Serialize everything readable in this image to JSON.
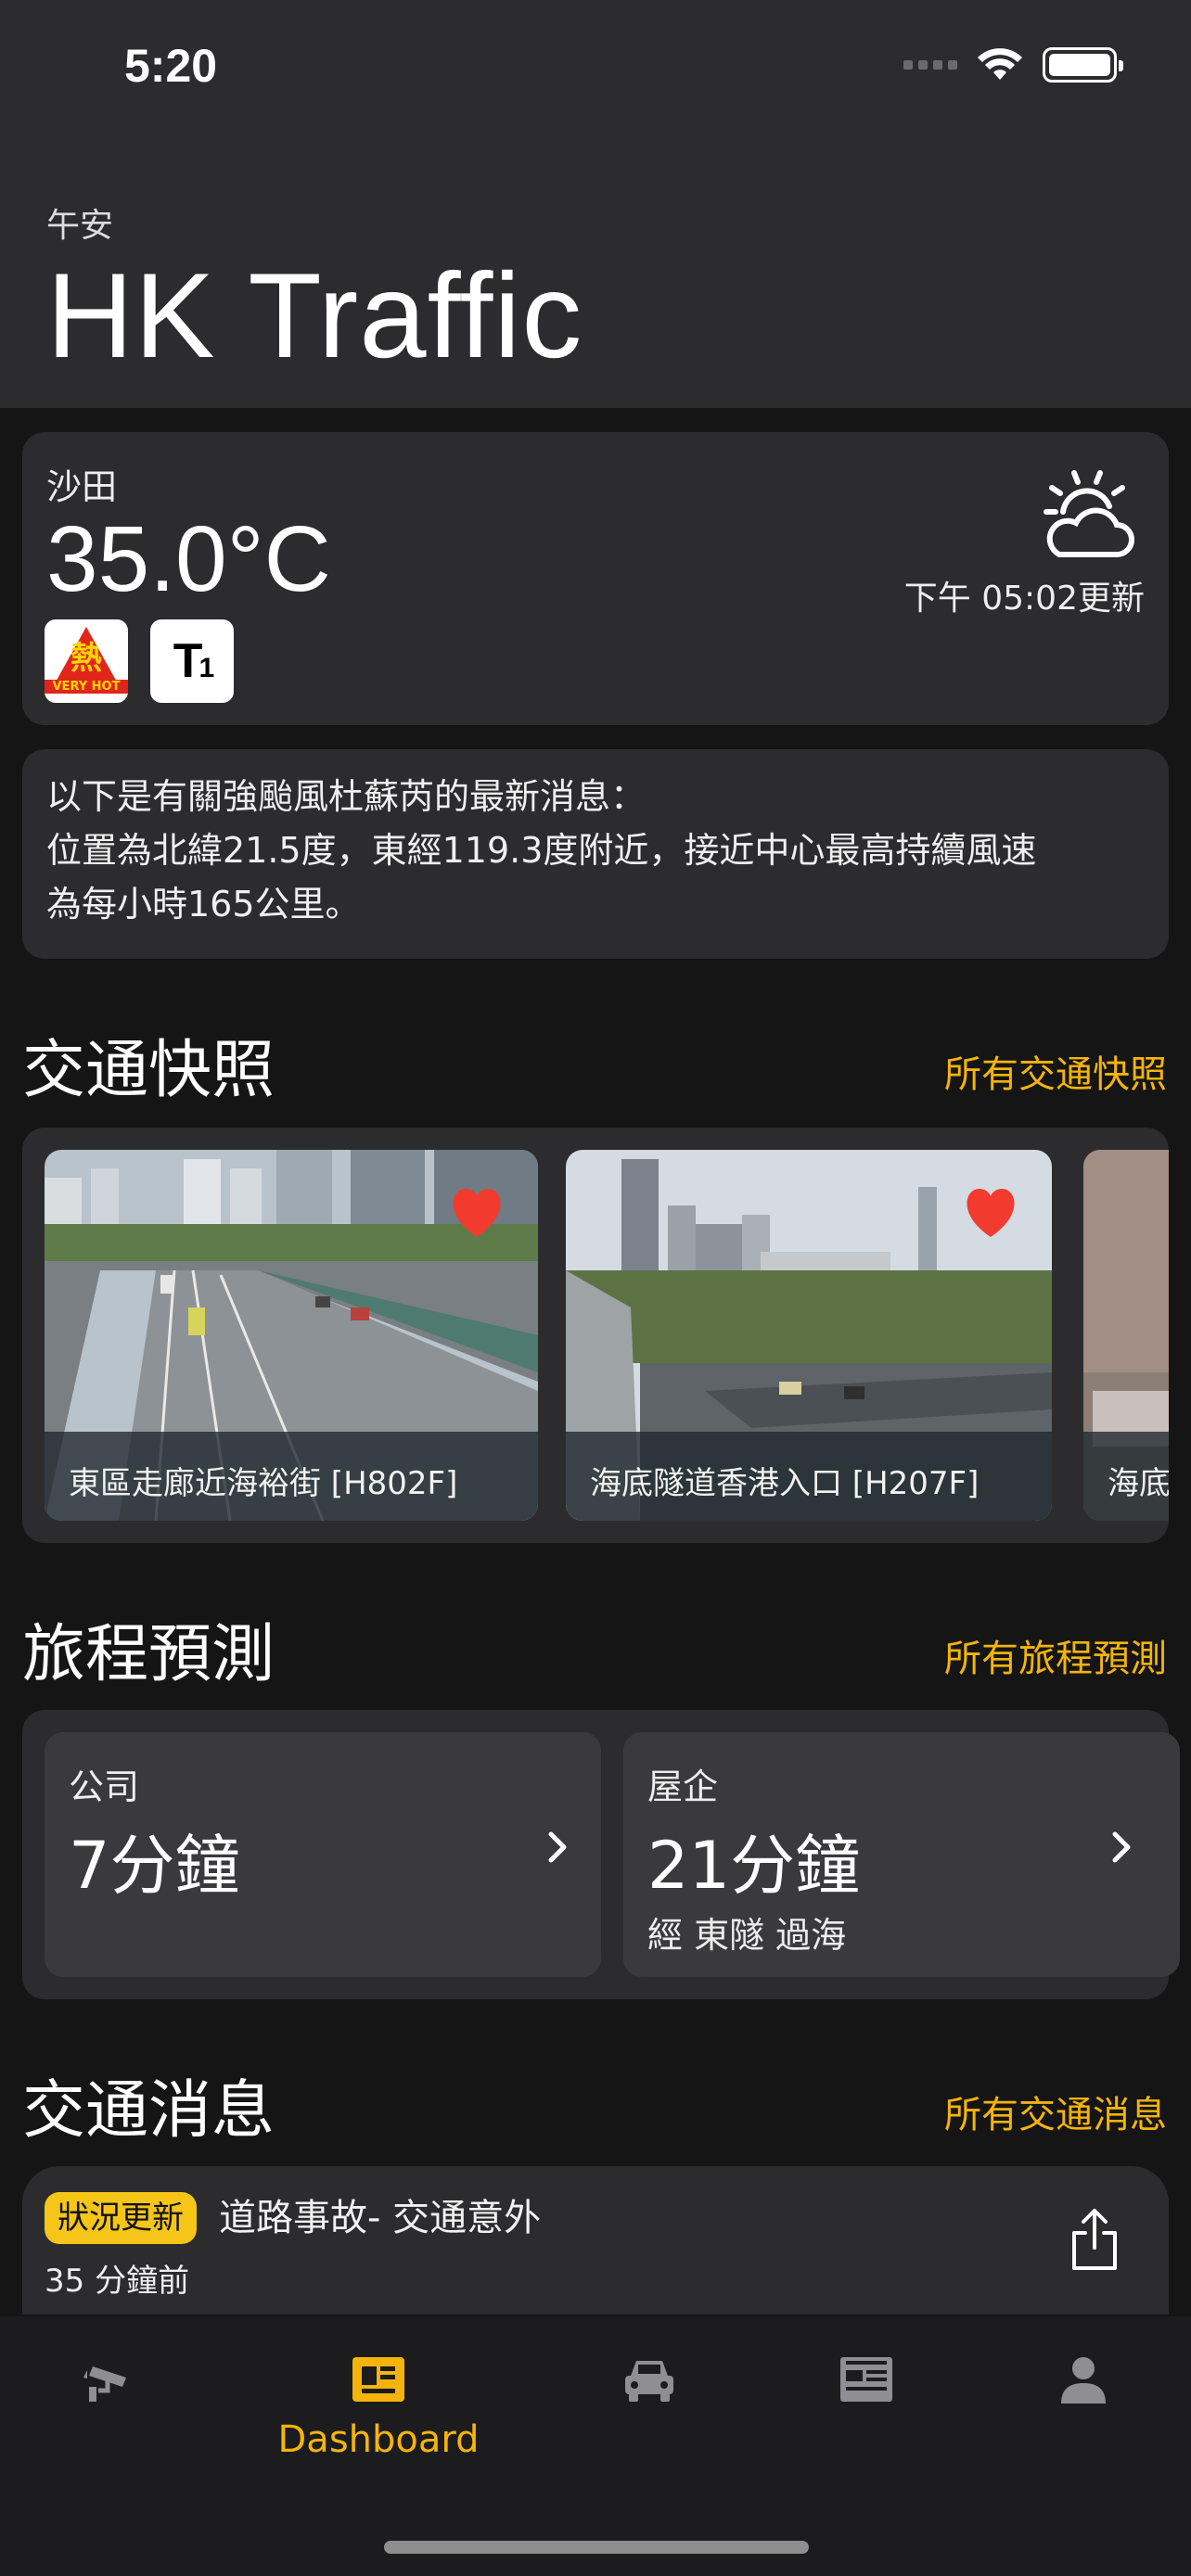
{
  "status_bar": {
    "time": "5:20"
  },
  "header": {
    "greeting": "午安",
    "title": "HK Traffic"
  },
  "weather": {
    "district": "沙田",
    "temperature": "35.0°C",
    "updated": "下午 05:02更新",
    "warnings": [
      {
        "icon": "very-hot-warning-icon",
        "text": "熱",
        "sub": "VERY HOT"
      },
      {
        "icon": "typhoon-signal-1-icon",
        "text": "T",
        "num": "1"
      }
    ],
    "condition_icon": "cloudy-sunny-icon"
  },
  "notice": {
    "lines": [
      "以下是有關強颱風杜蘇芮的最新消息：",
      "位置為北緯21.5度，東經119.3度附近，接近中心最高持續風速",
      "為每小時165公里。"
    ]
  },
  "snapshots": {
    "title": "交通快照",
    "link": "所有交通快照",
    "items": [
      {
        "caption": "東區走廊近海裕街 [H802F]",
        "favorite": true
      },
      {
        "caption": "海底隧道香港入口 [H207F]",
        "favorite": true
      },
      {
        "caption": "海底",
        "favorite": false
      }
    ]
  },
  "journey": {
    "title": "旅程預測",
    "link": "所有旅程預測",
    "items": [
      {
        "label": "公司",
        "time": "7分鐘",
        "via": ""
      },
      {
        "label": "屋企",
        "time": "21分鐘",
        "via": "經 東隧 過海"
      }
    ]
  },
  "news": {
    "title": "交通消息",
    "link": "所有交通消息",
    "items": [
      {
        "badge": "狀況更新",
        "title": "道路事故- 交通意外",
        "time": "35 分鐘前"
      }
    ]
  },
  "tabbar": {
    "items": [
      {
        "icon": "cctv-camera-icon",
        "label": ""
      },
      {
        "icon": "dashboard-icon",
        "label": "Dashboard",
        "active": true
      },
      {
        "icon": "car-icon",
        "label": ""
      },
      {
        "icon": "news-icon",
        "label": ""
      },
      {
        "icon": "profile-icon",
        "label": ""
      }
    ]
  },
  "colors": {
    "accent": "#f5b40a",
    "background": "#151515",
    "card": "#2c2c2e",
    "heart": "#f23b2f"
  }
}
